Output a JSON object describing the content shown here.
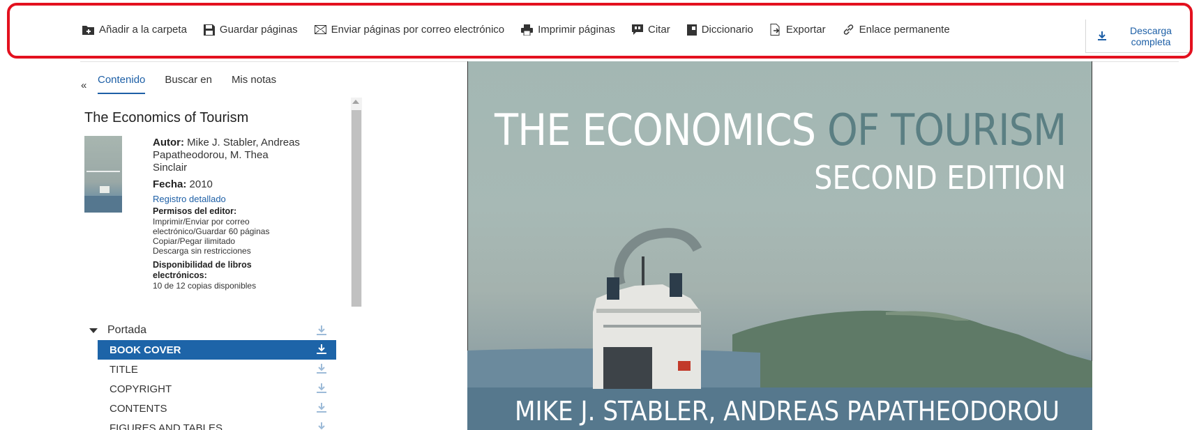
{
  "toolbar": {
    "items": [
      {
        "label": "Añadir a la carpeta",
        "icon": "folder-add-icon"
      },
      {
        "label": "Guardar páginas",
        "icon": "floppy-disk-icon"
      },
      {
        "label": "Enviar páginas por correo electrónico",
        "icon": "envelope-icon"
      },
      {
        "label": "Imprimir páginas",
        "icon": "printer-icon"
      },
      {
        "label": "Citar",
        "icon": "quote-icon"
      },
      {
        "label": "Diccionario",
        "icon": "dictionary-icon"
      },
      {
        "label": "Exportar",
        "icon": "export-icon"
      },
      {
        "label": "Enlace permanente",
        "icon": "link-icon"
      }
    ],
    "download_full_line1": "Descarga",
    "download_full_line2": "completa"
  },
  "tabs": {
    "collapse": "«",
    "contents": "Contenido",
    "search": "Buscar en",
    "notes": "Mis notas"
  },
  "book": {
    "title": "The Economics of Tourism",
    "author_label": "Autor:",
    "author_value": "Mike J. Stabler, Andreas Papatheodorou, M. Thea Sinclair",
    "date_label": "Fecha:",
    "date_value": "2010",
    "detail_link": "Registro detallado",
    "permissions_label": "Permisos del editor:",
    "permissions_line1": "Imprimir/Enviar por correo electrónico/Guardar 60 páginas",
    "permissions_line2": "Copiar/Pegar ilimitado",
    "permissions_line3": "Descarga sin restricciones",
    "availability_label": "Disponibilidad de libros electrónicos:",
    "availability_value": "10 de 12 copias disponibles"
  },
  "toc": {
    "section": "Portada",
    "rows": [
      "BOOK COVER",
      "TITLE",
      "COPYRIGHT",
      "CONTENTS",
      "FIGURES AND TABLES"
    ]
  },
  "cover": {
    "title_main": "THE ECONOMICS",
    "title_accent": "OF TOURISM",
    "subtitle": "SECOND EDITION",
    "authors": "MIKE J. STABLER, ANDREAS PAPATHEODOROU"
  },
  "colors": {
    "accent_blue": "#1d64a8",
    "highlight_red": "#e3111f"
  }
}
